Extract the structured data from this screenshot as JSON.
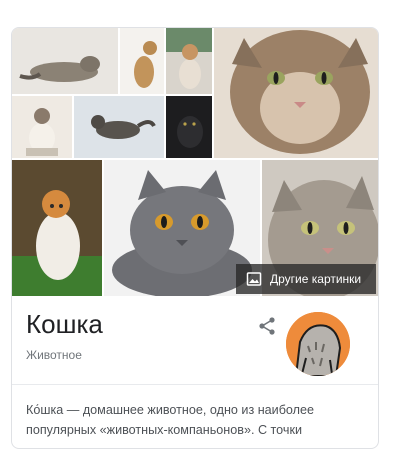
{
  "panel": {
    "title": "Кошка",
    "subtitle": "Животное",
    "more_images_label": "Другие картинки",
    "description": "Ко́шка — домашнее животное, одно из наиболее популярных «животных-компаньонов». С точки"
  },
  "colors": {
    "card_border": "#dfe1e5",
    "title_text": "#202124",
    "subtitle_text": "#70757a",
    "body_text": "#4d5156",
    "logo_orange": "#ee8b3b"
  },
  "icons": {
    "share": "share-icon",
    "image": "image-icon"
  }
}
